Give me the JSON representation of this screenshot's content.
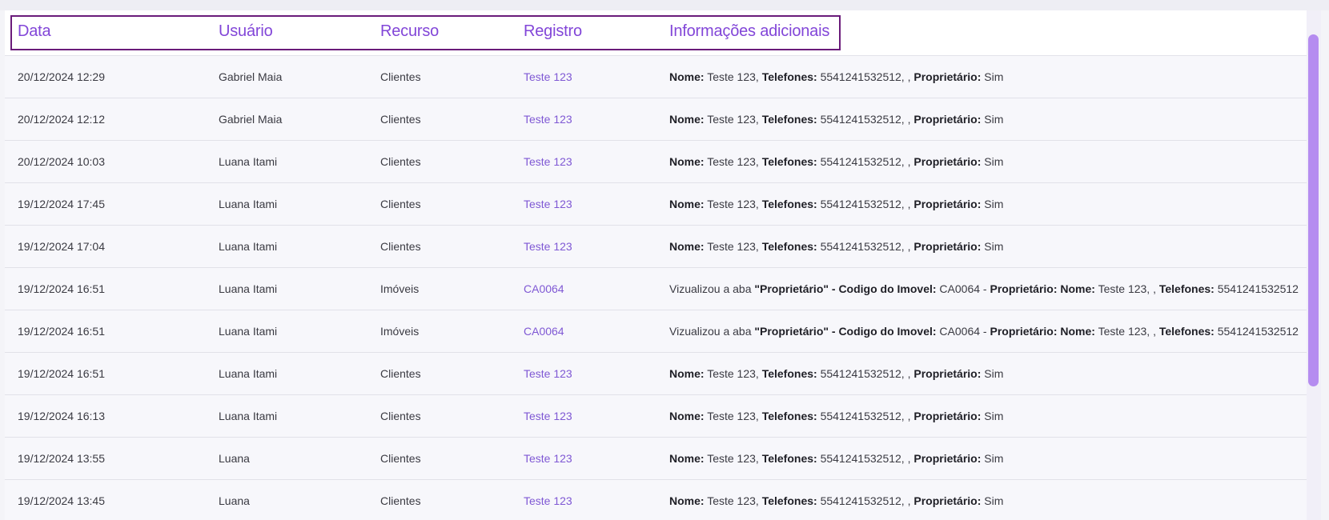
{
  "table": {
    "headers": {
      "date": "Data",
      "user": "Usuário",
      "resource": "Recurso",
      "record": "Registro",
      "info": "Informações adicionais"
    },
    "rows": [
      {
        "date": "20/12/2024 12:29",
        "user": "Gabriel Maia",
        "resource": "Clientes",
        "record": "Teste 123",
        "info": [
          {
            "b": "Nome:"
          },
          {
            "t": " Teste 123, "
          },
          {
            "b": "Telefones:"
          },
          {
            "t": " 5541241532512, , "
          },
          {
            "b": "Proprietário:"
          },
          {
            "t": " Sim"
          }
        ]
      },
      {
        "date": "20/12/2024 12:12",
        "user": "Gabriel Maia",
        "resource": "Clientes",
        "record": "Teste 123",
        "info": [
          {
            "b": "Nome:"
          },
          {
            "t": " Teste 123, "
          },
          {
            "b": "Telefones:"
          },
          {
            "t": " 5541241532512, , "
          },
          {
            "b": "Proprietário:"
          },
          {
            "t": " Sim"
          }
        ]
      },
      {
        "date": "20/12/2024 10:03",
        "user": "Luana Itami",
        "resource": "Clientes",
        "record": "Teste 123",
        "info": [
          {
            "b": "Nome:"
          },
          {
            "t": " Teste 123, "
          },
          {
            "b": "Telefones:"
          },
          {
            "t": " 5541241532512, , "
          },
          {
            "b": "Proprietário:"
          },
          {
            "t": " Sim"
          }
        ]
      },
      {
        "date": "19/12/2024 17:45",
        "user": "Luana Itami",
        "resource": "Clientes",
        "record": "Teste 123",
        "info": [
          {
            "b": "Nome:"
          },
          {
            "t": " Teste 123, "
          },
          {
            "b": "Telefones:"
          },
          {
            "t": " 5541241532512, , "
          },
          {
            "b": "Proprietário:"
          },
          {
            "t": " Sim"
          }
        ]
      },
      {
        "date": "19/12/2024 17:04",
        "user": "Luana Itami",
        "resource": "Clientes",
        "record": "Teste 123",
        "info": [
          {
            "b": "Nome:"
          },
          {
            "t": " Teste 123, "
          },
          {
            "b": "Telefones:"
          },
          {
            "t": " 5541241532512, , "
          },
          {
            "b": "Proprietário:"
          },
          {
            "t": " Sim"
          }
        ]
      },
      {
        "date": "19/12/2024 16:51",
        "user": "Luana Itami",
        "resource": "Imóveis",
        "record": "CA0064",
        "info": [
          {
            "t": "Vizualizou a aba "
          },
          {
            "b": "\"Proprietário\" - Codigo do Imovel:"
          },
          {
            "t": " CA0064 - "
          },
          {
            "b": "Proprietário: Nome:"
          },
          {
            "t": " Teste 123, , "
          },
          {
            "b": "Telefones:"
          },
          {
            "t": " 5541241532512"
          }
        ]
      },
      {
        "date": "19/12/2024 16:51",
        "user": "Luana Itami",
        "resource": "Imóveis",
        "record": "CA0064",
        "info": [
          {
            "t": "Vizualizou a aba "
          },
          {
            "b": "\"Proprietário\" - Codigo do Imovel:"
          },
          {
            "t": " CA0064 - "
          },
          {
            "b": "Proprietário: Nome:"
          },
          {
            "t": " Teste 123, , "
          },
          {
            "b": "Telefones:"
          },
          {
            "t": " 5541241532512"
          }
        ]
      },
      {
        "date": "19/12/2024 16:51",
        "user": "Luana Itami",
        "resource": "Clientes",
        "record": "Teste 123",
        "info": [
          {
            "b": "Nome:"
          },
          {
            "t": " Teste 123, "
          },
          {
            "b": "Telefones:"
          },
          {
            "t": " 5541241532512, , "
          },
          {
            "b": "Proprietário:"
          },
          {
            "t": " Sim"
          }
        ]
      },
      {
        "date": "19/12/2024 16:13",
        "user": "Luana Itami",
        "resource": "Clientes",
        "record": "Teste 123",
        "info": [
          {
            "b": "Nome:"
          },
          {
            "t": " Teste 123, "
          },
          {
            "b": "Telefones:"
          },
          {
            "t": " 5541241532512, , "
          },
          {
            "b": "Proprietário:"
          },
          {
            "t": " Sim"
          }
        ]
      },
      {
        "date": "19/12/2024 13:55",
        "user": "Luana",
        "resource": "Clientes",
        "record": "Teste 123",
        "info": [
          {
            "b": "Nome:"
          },
          {
            "t": " Teste 123, "
          },
          {
            "b": "Telefones:"
          },
          {
            "t": " 5541241532512, , "
          },
          {
            "b": "Proprietário:"
          },
          {
            "t": " Sim"
          }
        ]
      },
      {
        "date": "19/12/2024 13:45",
        "user": "Luana",
        "resource": "Clientes",
        "record": "Teste 123",
        "info": [
          {
            "b": "Nome:"
          },
          {
            "t": " Teste 123, "
          },
          {
            "b": "Telefones:"
          },
          {
            "t": " 5541241532512, , "
          },
          {
            "b": "Proprietário:"
          },
          {
            "t": " Sim"
          }
        ]
      }
    ]
  },
  "colors": {
    "accent": "#8246d8",
    "link": "#7f58d4",
    "header_outline": "#6a1b7a",
    "scrollbar_thumb": "#b58cf0"
  }
}
